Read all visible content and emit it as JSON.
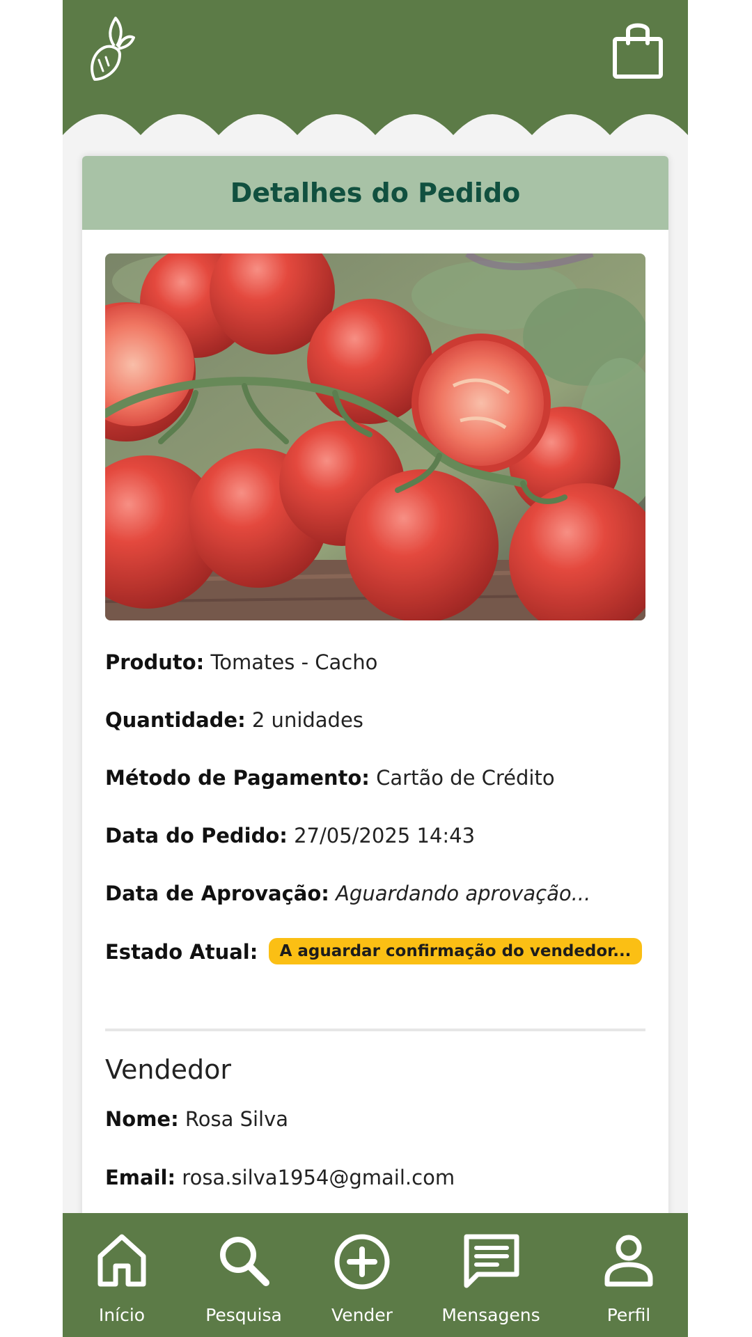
{
  "header": {
    "logo_icon": "radish-icon",
    "cart_icon": "shopping-bag-icon",
    "brand_color": "#5c7b47"
  },
  "order": {
    "title": "Detalhes do Pedido",
    "image_alt": "Tomates em cacho",
    "product_label": "Produto:",
    "product_value": "Tomates - Cacho",
    "quantity_label": "Quantidade:",
    "quantity_value": "2 unidades",
    "payment_label": "Método de Pagamento:",
    "payment_value": "Cartão de Crédito",
    "order_date_label": "Data do Pedido:",
    "order_date_value": "27/05/2025 14:43",
    "approval_date_label": "Data de Aprovação:",
    "approval_date_value": "Aguardando aprovação...",
    "status_label": "Estado Atual:",
    "status_value": "A aguardar confirmação do vendedor...",
    "status_color": "#fbbf14"
  },
  "seller": {
    "title": "Vendedor",
    "name_label": "Nome:",
    "name_value": "Rosa Silva",
    "email_label": "Email:",
    "email_value": "rosa.silva1954@gmail.com"
  },
  "nav": {
    "items": [
      {
        "label": "Início",
        "icon": "home-icon"
      },
      {
        "label": "Pesquisa",
        "icon": "search-icon"
      },
      {
        "label": "Vender",
        "icon": "add-circle-icon"
      },
      {
        "label": "Mensagens",
        "icon": "message-icon"
      },
      {
        "label": "Perfil",
        "icon": "user-icon"
      }
    ]
  }
}
